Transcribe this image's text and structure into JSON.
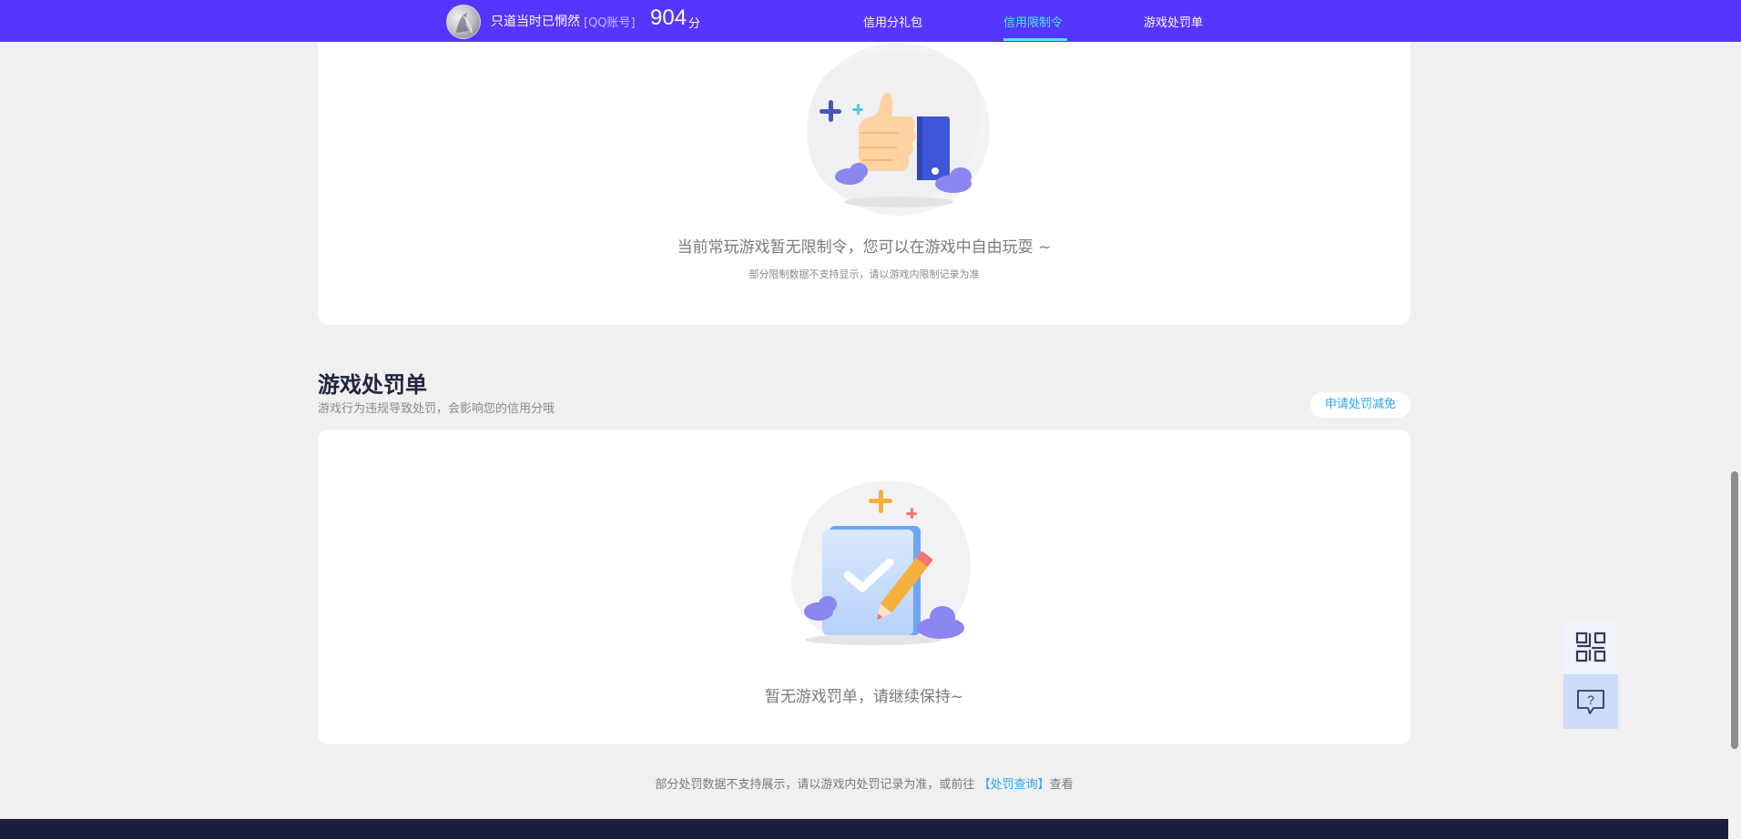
{
  "header": {
    "nickname": "只道当时已惘然",
    "account_type": "[QQ账号]",
    "score": "904",
    "score_unit": "分",
    "nav": [
      {
        "label": "信用分礼包",
        "active": false
      },
      {
        "label": "信用限制令",
        "active": true
      },
      {
        "label": "游戏处罚单",
        "active": false
      }
    ],
    "accent_color": "#5436ff",
    "active_color": "#4fe8f6"
  },
  "restriction_card": {
    "empty_text": "当前常玩游戏暂无限制令，您可以在游戏中自由玩耍 ~",
    "note": "部分限制数据不支持显示，请以游戏内限制记录为准",
    "illustration": "thumbs-up-illustration"
  },
  "penalty_section": {
    "title": "游戏处罚单",
    "description": "游戏行为违规导致处罚，会影响您的信用分哦",
    "appeal_button": "申请处罚减免",
    "empty_text": "暂无游戏罚单，请继续保持~",
    "illustration": "checklist-pencil-illustration"
  },
  "footer": {
    "note_prefix": "部分处罚数据不支持展示，请以游戏内处罚记录为准，或前往",
    "link_text": "【处罚查询】",
    "note_suffix": "查看"
  },
  "floating": {
    "qr_icon": "qr-code-icon",
    "help_icon": "help-chat-icon"
  }
}
